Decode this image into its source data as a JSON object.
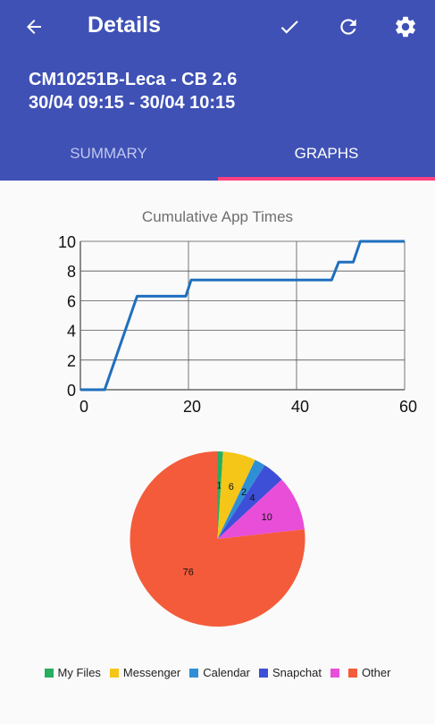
{
  "toolbar": {
    "title": "Details",
    "back_icon": "arrow-left-icon",
    "confirm_icon": "check-icon",
    "refresh_icon": "refresh-icon",
    "settings_icon": "gear-icon"
  },
  "header": {
    "line1": "CM10251B-Leca - CB 2.6",
    "line2": "30/04 09:15 - 30/04 10:15"
  },
  "tabs": [
    {
      "label": "SUMMARY",
      "active": false
    },
    {
      "label": "GRAPHS",
      "active": true
    }
  ],
  "colors": {
    "primary": "#3f51b5",
    "accent": "#ff4081",
    "line": "#1f6fbf"
  },
  "chart_data": [
    {
      "type": "line",
      "title": "Cumulative App Times",
      "xlim": [
        0,
        60
      ],
      "ylim": [
        0,
        10
      ],
      "x_ticks": [
        0,
        20,
        40,
        60
      ],
      "y_ticks": [
        0,
        2,
        4,
        6,
        8,
        10
      ],
      "grid": true,
      "series": [
        {
          "x": [
            0,
            4.5,
            10.5,
            19.5,
            20.5,
            46.5,
            47.8,
            50.5,
            51.8,
            60
          ],
          "y": [
            0,
            0,
            6.3,
            6.3,
            7.4,
            7.4,
            8.6,
            8.6,
            10,
            10
          ],
          "color": "#1f6fbf"
        }
      ]
    },
    {
      "type": "pie",
      "categories": [
        "My Files",
        "Messenger",
        "Calendar",
        "Snapchat",
        "Other",
        "Other"
      ],
      "values": [
        1,
        6,
        2,
        4,
        10,
        76
      ],
      "labels": [
        "1",
        "6",
        "2",
        "4",
        "10",
        "76"
      ],
      "colors": [
        "#27ae60",
        "#f5c518",
        "#2e8fd6",
        "#3d4fd6",
        "#e84ed8",
        "#f45b3a"
      ],
      "legend": [
        {
          "label": "My Files",
          "color": "#27ae60"
        },
        {
          "label": "Messenger",
          "color": "#f5c518"
        },
        {
          "label": "Calendar",
          "color": "#2e8fd6"
        },
        {
          "label": "Snapchat",
          "color": "#3d4fd6"
        },
        {
          "label": "",
          "color": "#e84ed8"
        },
        {
          "label": "Other",
          "color": "#f45b3a"
        }
      ],
      "legend_position": "bottom"
    }
  ]
}
